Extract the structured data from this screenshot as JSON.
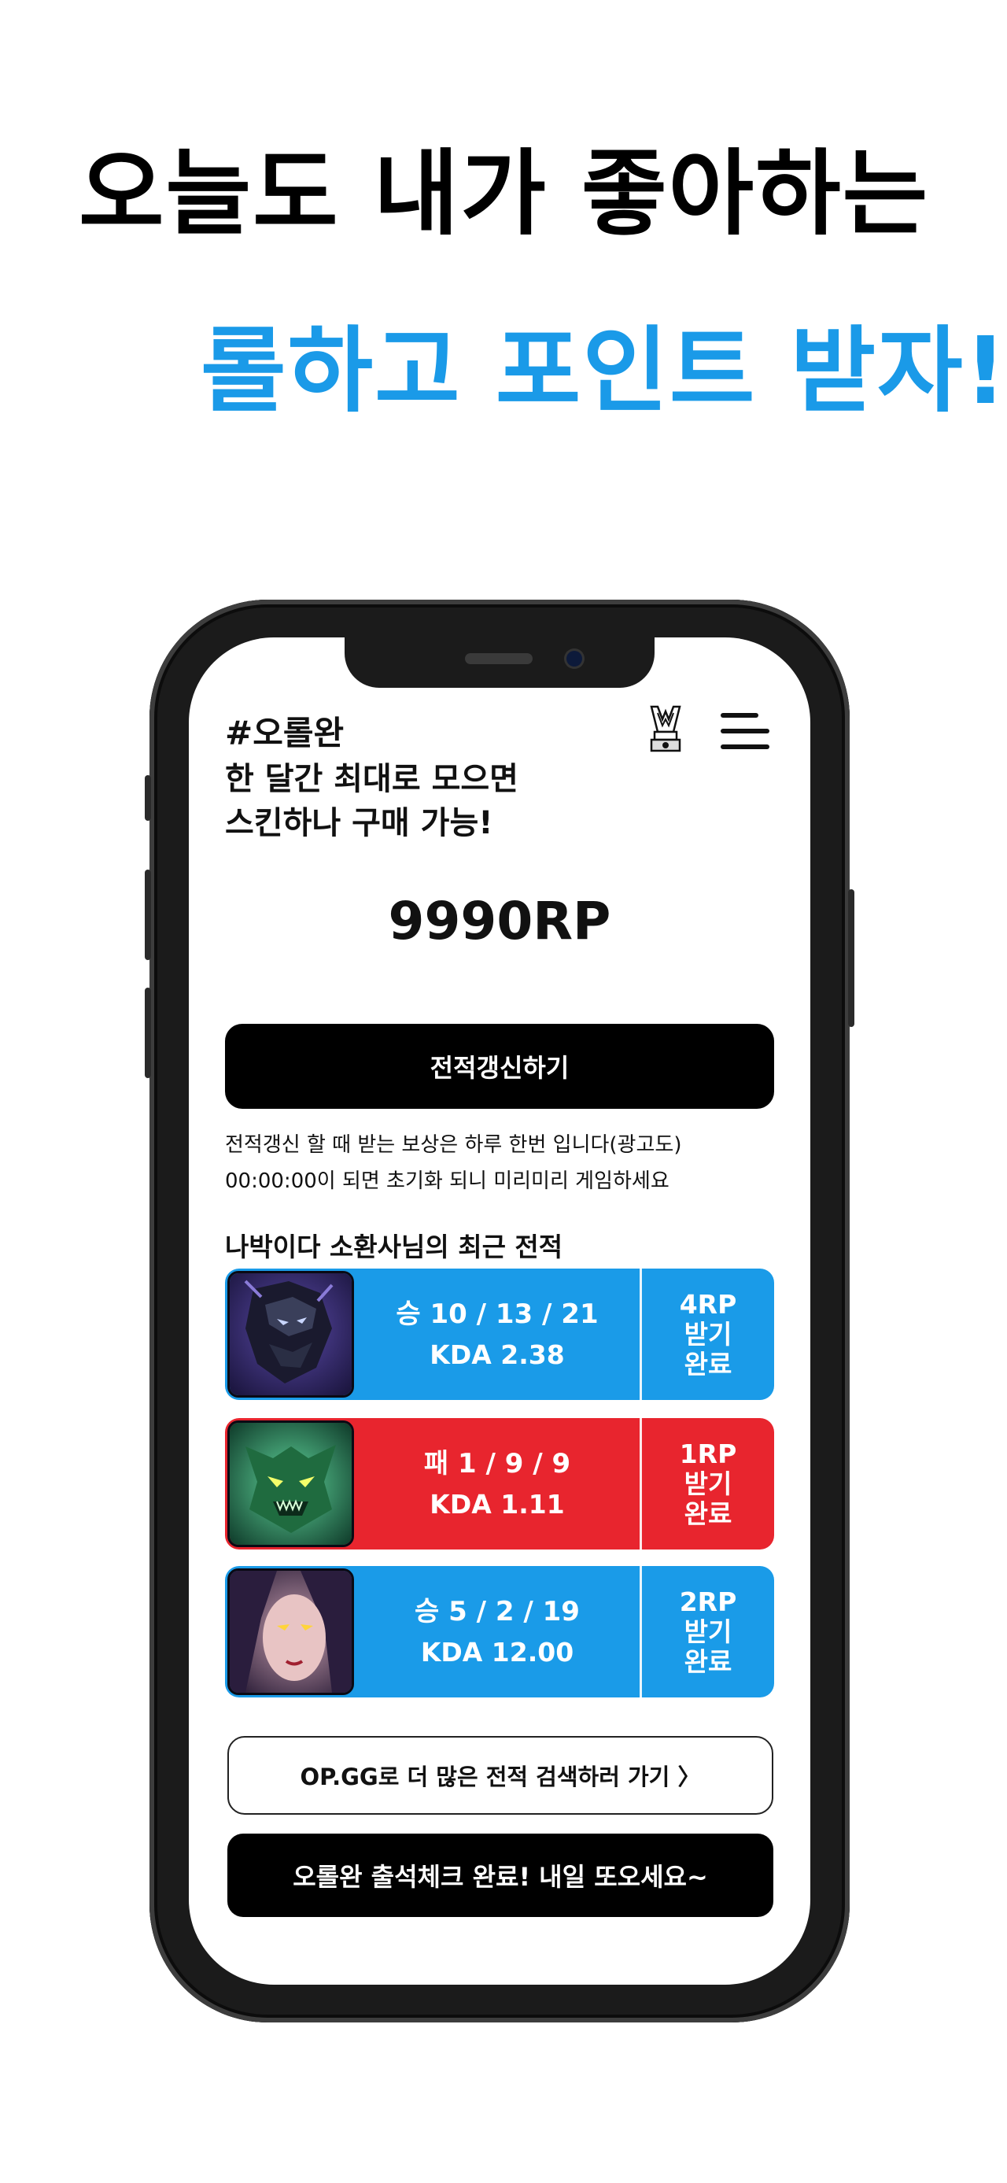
{
  "headline": {
    "line1": "오늘도 내가 좋아하는",
    "line2": "롤하고 포인트 받자!"
  },
  "app": {
    "title": "#오롤완",
    "subtitle_line1": "한 달간 최대로 모으면",
    "subtitle_line2": "스킨하나 구매 가능!",
    "points": "9990RP",
    "refresh_button": "전적갱신하기",
    "notice_line1": "전적갱신 할 때 받는 보상은 하루 한번 입니다(광고도)",
    "notice_line2": "00:00:00이 되면 초기화 되니 미리미리 게임하세요",
    "section_title": "나박이다 소환사님의 최근 전적",
    "matches": [
      {
        "result": "승  10 / 13 / 21",
        "kda": "KDA    2.38",
        "reward": [
          "4RP",
          "받기",
          "완료"
        ],
        "color": "#1a9be8"
      },
      {
        "result": "패  1 / 9 / 9",
        "kda": "KDA    1.11",
        "reward": [
          "1RP",
          "받기",
          "완료"
        ],
        "color": "#e8252e"
      },
      {
        "result": "승  5 / 2 / 19",
        "kda": "KDA    12.00",
        "reward": [
          "2RP",
          "받기",
          "완료"
        ],
        "color": "#1a9be8"
      }
    ],
    "opgg_button": "OP.GG로 더 많은 전적 검색하러 가기 〉",
    "attendance_button": "오롤완 출석체크 완료! 내일 또오세요~"
  },
  "icons": {
    "trophy": "trophy-icon",
    "menu": "hamburger-menu-icon"
  },
  "colors": {
    "accent_blue": "#1a9ae8",
    "win_blue": "#1a9be8",
    "loss_red": "#e8252e"
  }
}
